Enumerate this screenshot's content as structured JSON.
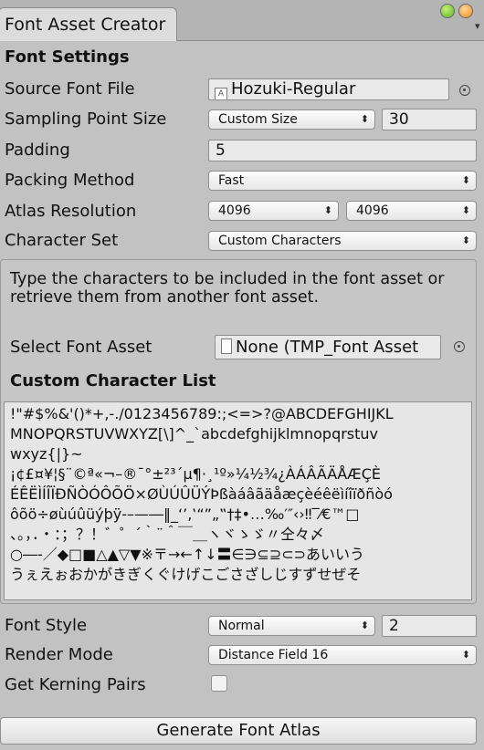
{
  "window": {
    "tab_title": "Font Asset Creator"
  },
  "font_settings": {
    "title": "Font Settings",
    "source_font_file": {
      "label": "Source Font File",
      "value": "Hozuki-Regular",
      "icon": "font-file-icon"
    },
    "sampling_point_size": {
      "label": "Sampling Point Size",
      "mode": "Custom Size",
      "value": "30"
    },
    "padding": {
      "label": "Padding",
      "value": "5"
    },
    "packing_method": {
      "label": "Packing Method",
      "value": "Fast"
    },
    "atlas_resolution": {
      "label": "Atlas Resolution",
      "width": "4096",
      "height": "4096"
    },
    "character_set": {
      "label": "Character Set",
      "value": "Custom Characters"
    }
  },
  "custom_chars": {
    "help": "Type the characters to be included in the font asset or retrieve them from another font asset.",
    "select_font_asset": {
      "label": "Select Font Asset",
      "value": "None (TMP_Font Asset"
    },
    "list_title": "Custom Character List",
    "lines": [
      "!\"#$%&'()*+,-./0123456789:;<=>?@ABCDEFGHIJKL",
      "MNOPQRSTUVWXYZ[\\]^_`abcdefghijklmnopqrstuv",
      "wxyz{|}~",
      "¡¢£¤¥¦§¨©ª«¬–®¯°±²³´µ¶·¸¹º»¼½¾¿ÀÁÂÃÄÅÆÇÈ",
      "ÉÊËÌÍÎÏÐÑÒÓÔÕÖ×ØÙÚÛÜÝÞßàáâãäåæçèéêëìíîïðñòó",
      "ôõö÷øùúûüýþÿ‐–—―‖_‘’‚‛“”„‟†‡•…‰′″‹›‼‾⁄€™□",
      "、。，．・：；？！゛゜´｀¨＾￣＿ヽヾゝゞ〃仝々〆",
      "○―‐／◆□■△▲▽▼※〒→←↑↓〓∈∋⊆⊇⊂⊃あいいう",
      "うぇえぉおかがきぎくぐけげこごさざしじすずせぜそ"
    ]
  },
  "font_style": {
    "label": "Font Style",
    "value": "Normal",
    "amount": "2"
  },
  "render_mode": {
    "label": "Render Mode",
    "value": "Distance Field 16"
  },
  "kerning": {
    "label": "Get Kerning Pairs",
    "checked": false
  },
  "generate_button": "Generate Font Atlas"
}
